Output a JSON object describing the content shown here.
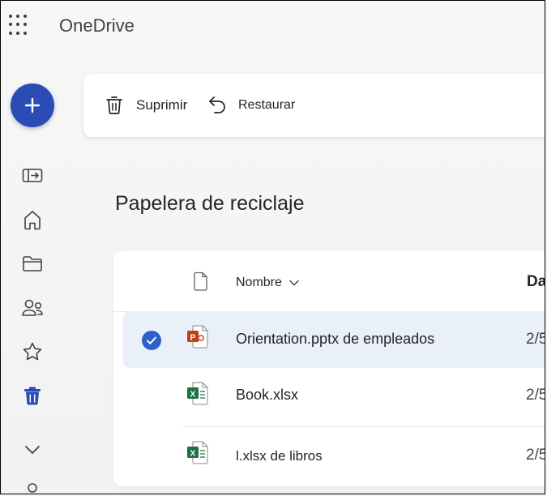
{
  "app": {
    "title": "OneDrive"
  },
  "sidebar": {
    "new_icon": "plus-icon",
    "items": [
      {
        "name": "collapse-pane-icon"
      },
      {
        "name": "home-icon"
      },
      {
        "name": "folder-icon"
      },
      {
        "name": "people-icon"
      },
      {
        "name": "star-icon"
      },
      {
        "name": "trash-icon",
        "active": true
      },
      {
        "name": "chevron-down-icon"
      },
      {
        "name": "person-icon"
      }
    ]
  },
  "toolbar": {
    "delete_label": "Suprimir",
    "restore_label": "Restaurar"
  },
  "page": {
    "title": "Papelera de reciclaje"
  },
  "table": {
    "columns": {
      "name": "Nombre",
      "date": "Da"
    },
    "rows": [
      {
        "name": "Orientation.pptx de empleados",
        "type": "pptx",
        "date": "2/5",
        "selected": true
      },
      {
        "name": "Book.xlsx",
        "type": "xlsx",
        "date": "2/5",
        "selected": false
      },
      {
        "name": "l.xlsx de libros",
        "type": "xlsx",
        "date": "2/5",
        "selected": false
      }
    ]
  },
  "colors": {
    "accent": "#2b4bb7",
    "selected_row": "#eaf0fa",
    "excel": "#1e7145",
    "powerpoint": "#c43e1c"
  }
}
